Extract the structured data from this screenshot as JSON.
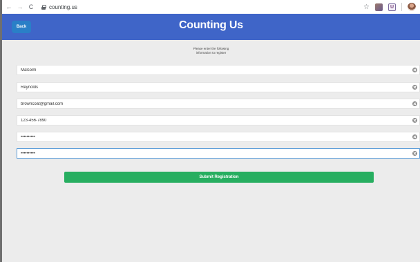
{
  "browser": {
    "back_glyph": "←",
    "forward_glyph": "→",
    "reload_glyph": "C",
    "url": "counting.us",
    "star_glyph": "☆",
    "ext2_glyph": "U"
  },
  "header": {
    "back_label": "Back",
    "title": "Counting Us",
    "color": "#3f65c8"
  },
  "form": {
    "instruction_line1": "Please enter the following",
    "instruction_line2": "information to register",
    "fields": [
      {
        "value": "Malcolm",
        "type": "text"
      },
      {
        "value": "Reynolds",
        "type": "text"
      },
      {
        "value": "browncoat@gmail.com",
        "type": "email"
      },
      {
        "value": "123-456-7890",
        "type": "tel"
      },
      {
        "value": "••••••••••",
        "type": "password"
      },
      {
        "value": "••••••••••",
        "type": "password"
      }
    ],
    "submit_label": "Submit Registration",
    "submit_color": "#27ae60"
  }
}
